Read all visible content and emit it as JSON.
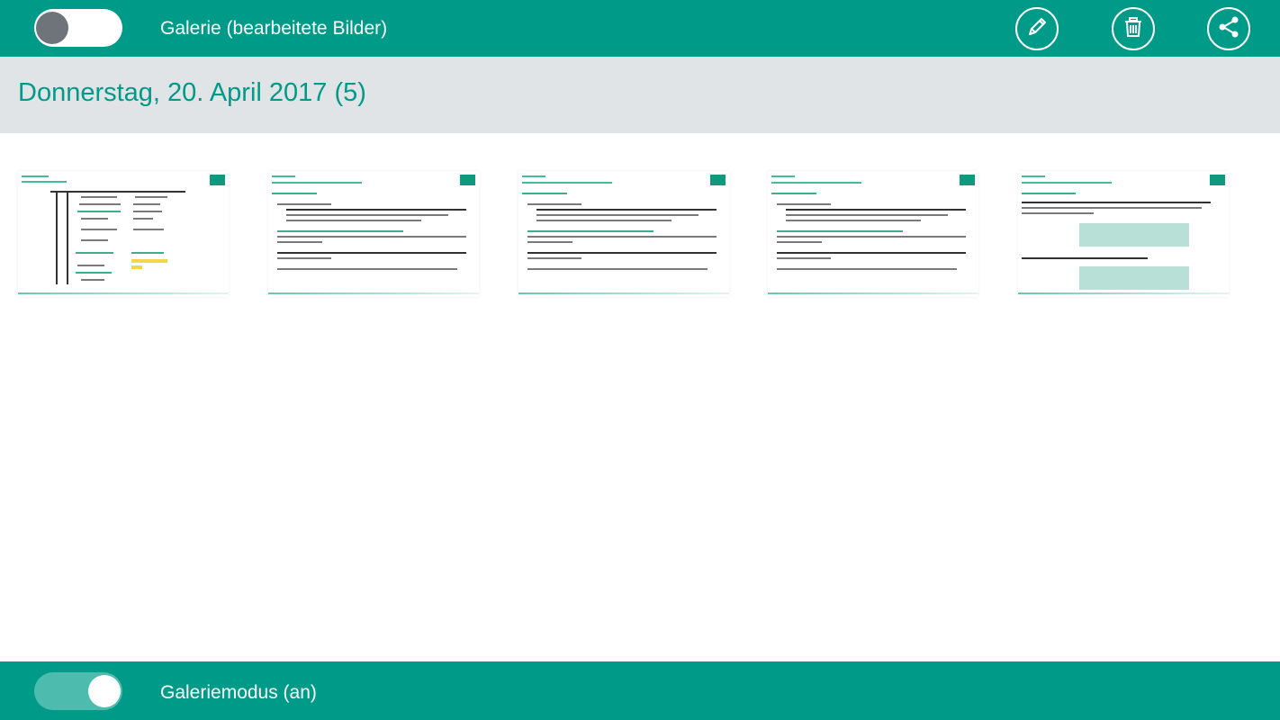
{
  "top_bar": {
    "gallery_toggle_state": "off",
    "title": "Galerie (bearbeitete Bilder)",
    "edit_icon": "pencil-icon",
    "delete_icon": "trash-icon",
    "share_icon": "share-icon"
  },
  "section": {
    "date_title": "Donnerstag, 20. April 2017 (5)"
  },
  "thumbnails": [
    {
      "kind": "table"
    },
    {
      "kind": "text"
    },
    {
      "kind": "text"
    },
    {
      "kind": "text"
    },
    {
      "kind": "boxes"
    }
  ],
  "bottom_bar": {
    "mode_toggle_state": "on",
    "label": "Galeriemodus (an)"
  },
  "colors": {
    "accent": "#009a88",
    "header_bg": "#e1e4e6",
    "toggle_on": "#4dbcaf",
    "toggle_knob_off": "#6e7479"
  }
}
